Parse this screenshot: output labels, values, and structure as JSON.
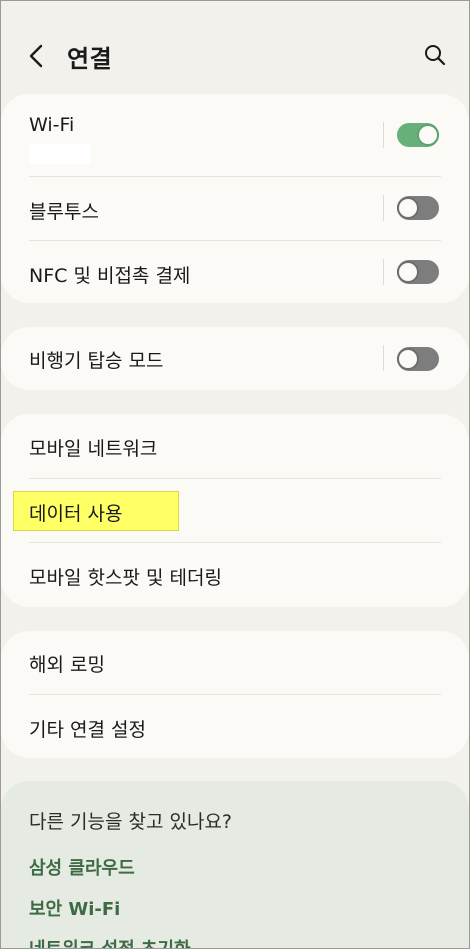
{
  "header": {
    "title": "연결",
    "back_icon": "chevron-left-icon",
    "search_icon": "search-icon"
  },
  "colors": {
    "background": "#f2f1ec",
    "card": "#fbfaf6",
    "toggle_on": "#67b07a",
    "toggle_off": "#7d7d7d",
    "highlight": "#ffff66",
    "suggest_bg": "#e5ebe3",
    "link": "#3d6b44"
  },
  "group1": {
    "wifi": {
      "label": "Wi-Fi",
      "toggle": "on"
    },
    "bluetooth": {
      "label": "블루투스",
      "toggle": "off"
    },
    "nfc": {
      "label": "NFC 및 비접촉 결제",
      "toggle": "off"
    }
  },
  "group2": {
    "airplane": {
      "label": "비행기 탑승 모드",
      "toggle": "off"
    }
  },
  "group3": {
    "mobile_network": {
      "label": "모바일 네트워크"
    },
    "data_usage": {
      "label": "데이터 사용",
      "highlighted": true
    },
    "hotspot": {
      "label": "모바일 핫스팟 및 테더링"
    }
  },
  "group4": {
    "roaming": {
      "label": "해외 로밍"
    },
    "more": {
      "label": "기타 연결 설정"
    }
  },
  "suggestions": {
    "title": "다른 기능을 찾고 있나요?",
    "links": [
      "삼성 클라우드",
      "보안 Wi-Fi",
      "네트워크 설정 초기화"
    ]
  }
}
